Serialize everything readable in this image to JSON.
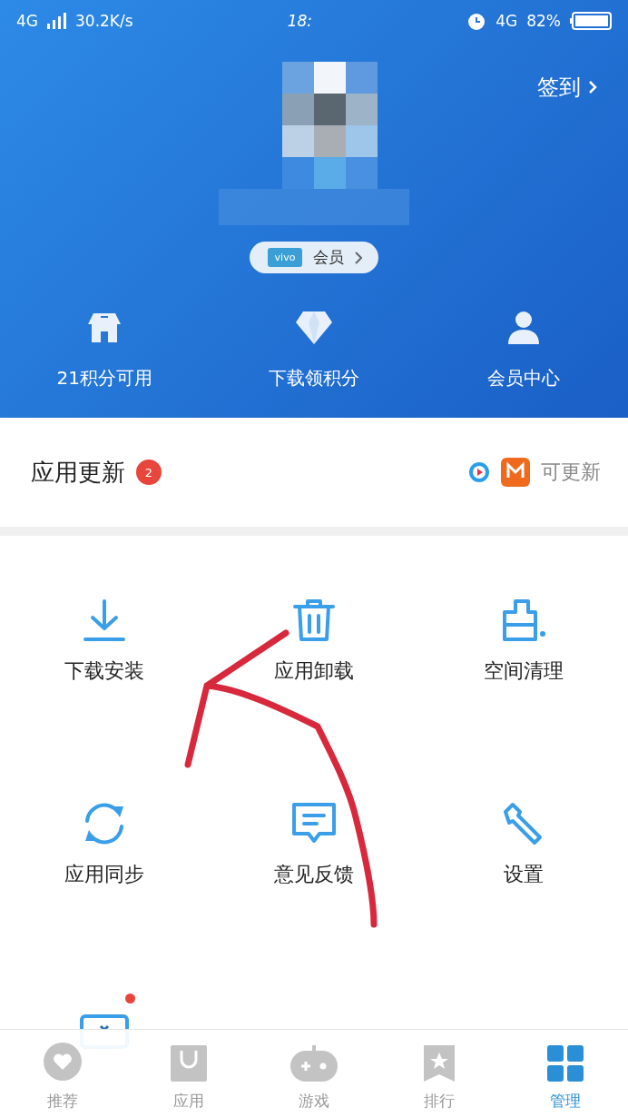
{
  "status_bar": {
    "network": "4G",
    "speed": "30.2K/s",
    "time": "18:",
    "network_right": "4G",
    "battery": "82%"
  },
  "header": {
    "checkin": "签到",
    "member_pill": {
      "brand": "vivo",
      "label": "会员"
    },
    "shortcuts": [
      {
        "kind": "store",
        "label": "21积分可用"
      },
      {
        "kind": "diamond",
        "label": "下载领积分"
      },
      {
        "kind": "person",
        "label": "会员中心"
      }
    ]
  },
  "updates": {
    "title": "应用更新",
    "badge": "2",
    "status": "可更新",
    "apps": [
      {
        "kind": "play"
      },
      {
        "kind": "mango"
      }
    ]
  },
  "grid": [
    {
      "kind": "download",
      "label": "下载安装",
      "dot": false
    },
    {
      "kind": "trash",
      "label": "应用卸载",
      "dot": false
    },
    {
      "kind": "clean",
      "label": "空间清理",
      "dot": false
    },
    {
      "kind": "sync",
      "label": "应用同步",
      "dot": false
    },
    {
      "kind": "feedback",
      "label": "意见反馈",
      "dot": false
    },
    {
      "kind": "wrench",
      "label": "设置",
      "dot": false
    },
    {
      "kind": "card",
      "dot": true
    }
  ],
  "annotation": {
    "kind": "arrow"
  },
  "tabs": [
    {
      "kind": "heart",
      "label": "推荐",
      "selected": false
    },
    {
      "kind": "bag",
      "label": "应用",
      "selected": false
    },
    {
      "kind": "gamepad",
      "label": "游戏",
      "selected": false
    },
    {
      "kind": "ranking",
      "label": "排行",
      "selected": false
    },
    {
      "kind": "manage",
      "label": "管理",
      "selected": true
    }
  ]
}
